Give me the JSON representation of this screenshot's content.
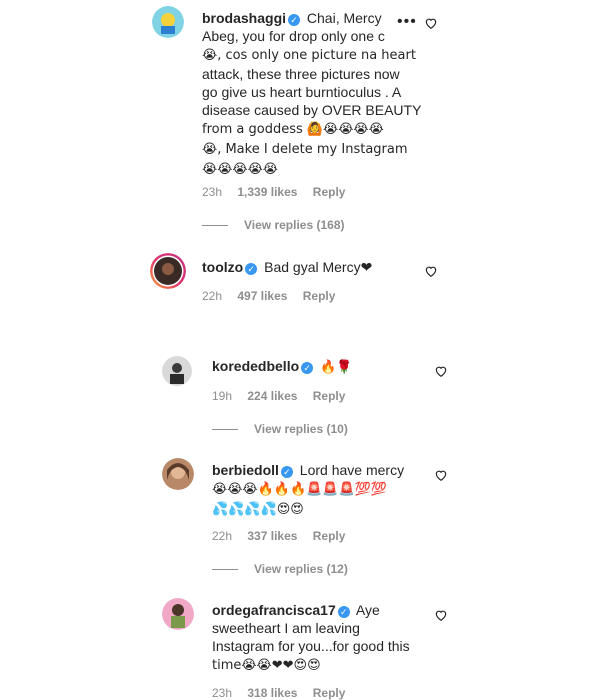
{
  "comments": [
    {
      "username": "brodashaggi",
      "text_lines": [
        "Chai, Mercy",
        "Abeg, you for drop only one c",
        "😭, cos only one picture na heart",
        "attack, these three pictures now",
        "go give us heart burntioculus . A",
        "disease caused by OVER BEAUTY",
        "from a goddess 🙆😭😭😭😭",
        "😭, Make I delete my Instagram",
        "😭😭😭😭😭"
      ],
      "time": "23h",
      "likes": "1,339 likes",
      "reply": "Reply",
      "view_replies": "View replies (168)"
    },
    {
      "username": "toolzo",
      "text": "Bad gyal Mercy❤",
      "time": "22h",
      "likes": "497 likes",
      "reply": "Reply"
    },
    {
      "username": "korededbello",
      "username_display": "korededbello",
      "text": "🔥🌹",
      "time": "19h",
      "likes": "224 likes",
      "reply": "Reply",
      "view_replies": "View replies (10)"
    },
    {
      "username": "berbiedoll",
      "text_lines": [
        "Lord have mercy",
        "😭😭😭🔥🔥🔥🚨🚨🚨💯💯",
        "💦💦💦💦😍😍"
      ],
      "time": "22h",
      "likes": "337 likes",
      "reply": "Reply",
      "view_replies": "View replies (12)"
    },
    {
      "username": "ordegafrancisca17",
      "text_lines": [
        "Aye",
        "sweetheart I am leaving",
        "Instagram for you...for good this",
        "time😭😭❤❤😍😍"
      ],
      "time": "23h",
      "likes": "318 likes",
      "reply": "Reply"
    }
  ],
  "icons": {
    "more": "more-options-icon",
    "heart": "heart-outline-icon",
    "verified": "verified-badge-icon"
  },
  "colors": {
    "verified": "#3897f0",
    "muted": "#8e8e8e",
    "text": "#262626"
  }
}
